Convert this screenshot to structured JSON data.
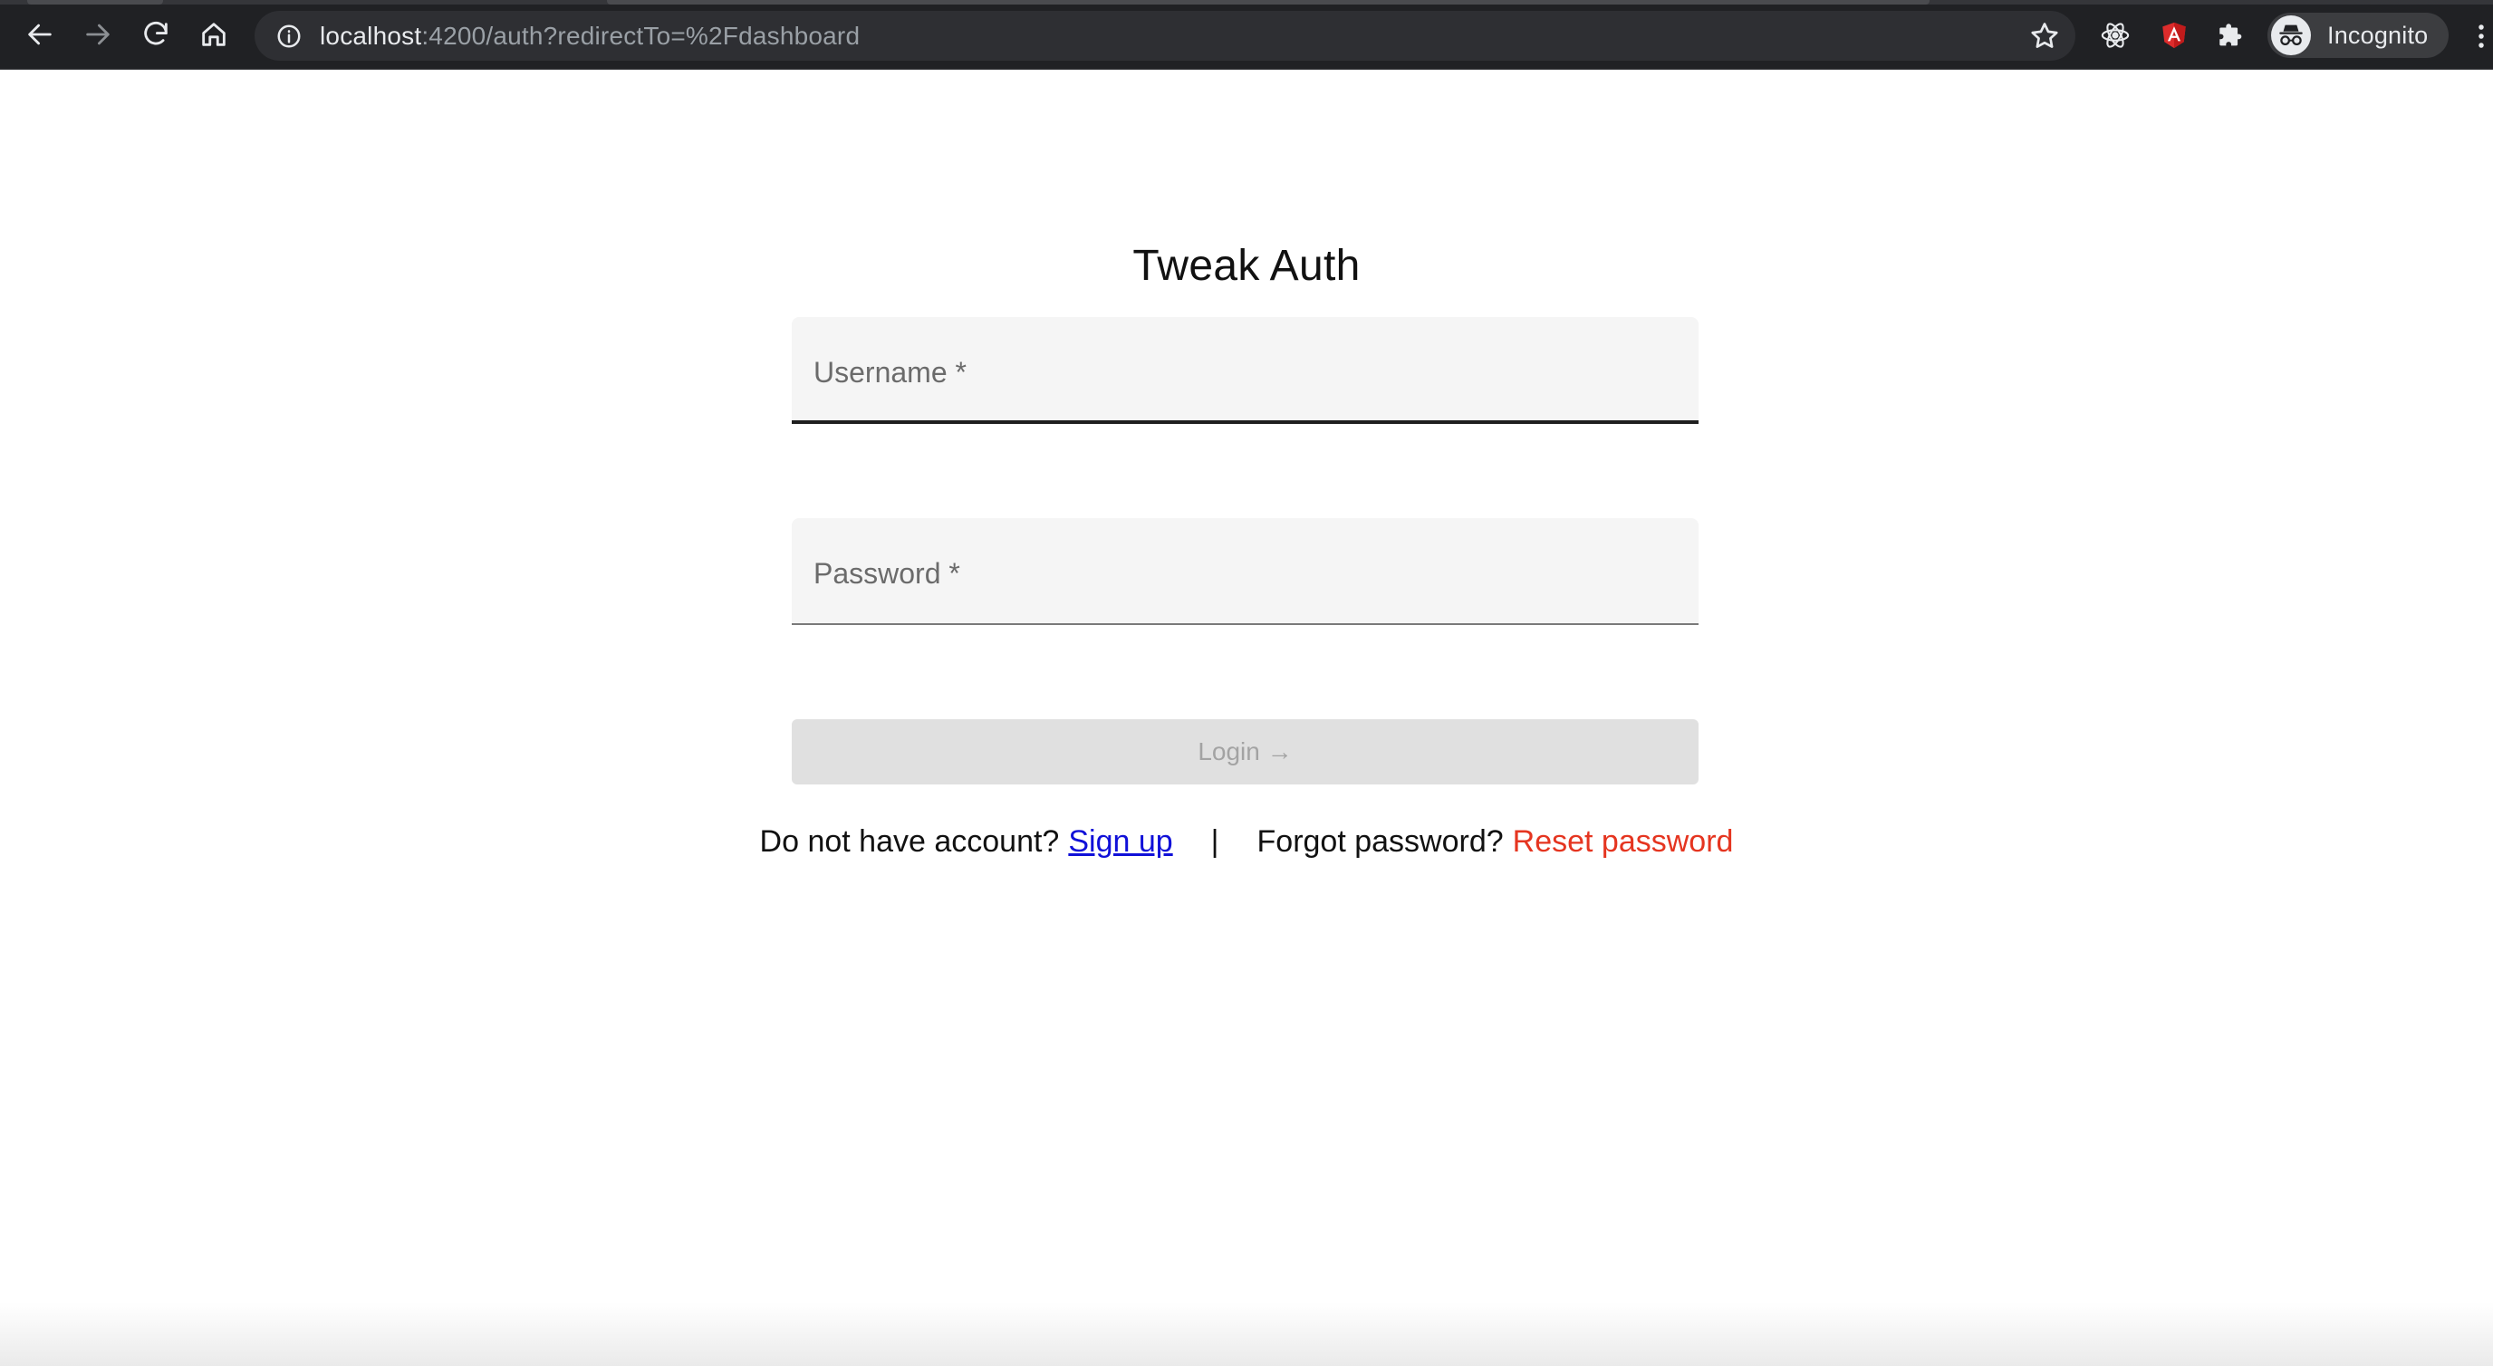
{
  "browser": {
    "url_host": "localhost",
    "url_rest": ":4200/auth?redirectTo=%2Fdashboard",
    "profile_label": "Incognito",
    "icons": {
      "back": "back-arrow-icon",
      "forward": "forward-arrow-icon",
      "reload": "reload-icon",
      "home": "home-icon",
      "site_info": "info-icon",
      "bookmark": "star-icon",
      "react_devtools": "react-icon",
      "angular_devtools": "angular-icon",
      "extensions": "puzzle-icon",
      "profile": "incognito-icon",
      "menu": "kebab-menu-icon"
    }
  },
  "auth": {
    "title": "Tweak Auth",
    "username": {
      "label": "Username *",
      "value": ""
    },
    "password": {
      "label": "Password *",
      "value": ""
    },
    "login_label": "Login →",
    "signup_prompt": "Do not have account?",
    "signup_link": "Sign up",
    "separator": "|",
    "forgot_prompt": "Forgot password?",
    "reset_link": "Reset password"
  },
  "colors": {
    "chrome_bg": "#202124",
    "omnibox_bg": "#2e2f33",
    "signup_link": "#1010d8",
    "reset_link": "#e53520",
    "login_disabled_bg": "#e0e0e0"
  }
}
